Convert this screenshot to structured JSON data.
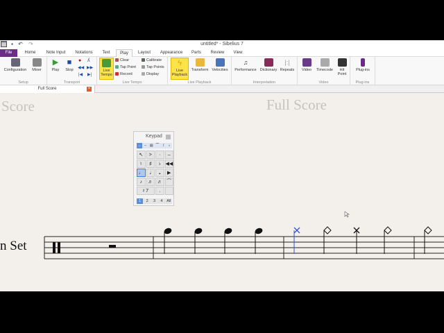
{
  "window": {
    "title": "untitled* - Sibelius 7"
  },
  "tabs": [
    "File",
    "Home",
    "Note Input",
    "Notations",
    "Text",
    "Play",
    "Layout",
    "Appearance",
    "Parts",
    "Review",
    "View"
  ],
  "ribbon": {
    "setup": {
      "label": "Setup",
      "configuration": "Configuration",
      "mixer": "Mixer"
    },
    "transport": {
      "label": "Transport",
      "play": "Play",
      "stop": "Stop"
    },
    "live_tempo": {
      "label": "Live Tempo",
      "live_tempo": "Live Tempo",
      "clear": "Clear",
      "tap_point": "Tap Point",
      "record": "Record",
      "calibrate": "Calibrate",
      "tap_points": "Tap Points",
      "display": "Display"
    },
    "live_playback": {
      "label": "Live Playback",
      "live_playback": "Live Playback",
      "transform": "Transform",
      "velocities": "Velocities"
    },
    "interpretation": {
      "label": "Interpretation",
      "performance": "Performance",
      "dictionary": "Dictionary",
      "repeats": "Repeats"
    },
    "video": {
      "label": "Video",
      "video": "Video",
      "timecode": "Timecode",
      "hit_point": "Hit Point"
    },
    "plugins": {
      "label": "Plug-ins",
      "plugins": "Plug-ins"
    }
  },
  "document_tab": {
    "label": "Full Score"
  },
  "score": {
    "title_left": "Score",
    "title_center": "Full Score",
    "instrument": "n Set"
  },
  "keypad": {
    "title": "Keypad",
    "layouts": [
      "1",
      "2",
      "3",
      "4",
      "All"
    ],
    "keys": [
      "↖",
      "&gt;",
      "·",
      "–",
      "♮",
      "♯",
      "♭",
      "◀◀",
      "♩",
      "𝅗𝅥",
      "𝅝",
      "▶",
      "♪",
      "♬",
      "♬",
      "⁀",
      "𝄽 7",
      "",
      ".",
      " "
    ]
  }
}
